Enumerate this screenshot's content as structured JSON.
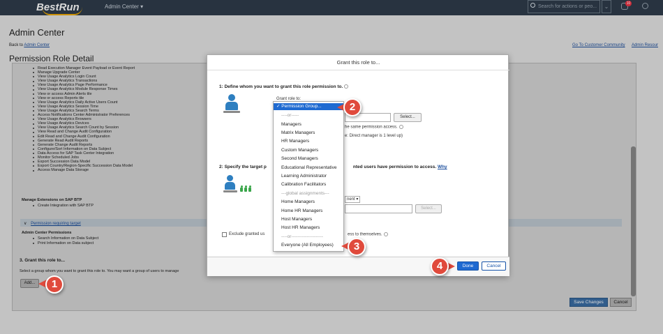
{
  "header": {
    "logo": "BestRun",
    "app_menu": "Admin Center ▾",
    "search_placeholder": "Search for actions or peo...",
    "notification_count": "10"
  },
  "page": {
    "title": "Admin Center",
    "back_prefix": "Back to ",
    "back_link": "Admin Center",
    "link_community": "Go To Customer Community",
    "link_resources": "Admin Resour",
    "section_title": "Permission Role Detail"
  },
  "permissions": [
    "Read Execution Manager Event Payload or Event Report",
    "Manage Upgrade Center",
    "View Usage Analytics Login Count",
    "View Usage Analytics Transactions",
    "View Usage Analytics Page Performance",
    "View Usage Analytics Module Response Times",
    "View or access Admin Alerts tile",
    "View or access Reports tile",
    "View Usage Analytics Daily Active Users Count",
    "View Usage Analytics Session Time",
    "View Usage Analytics Search Terms",
    "Access Notifications Center Administrator Preferences",
    "View Usage Analytics Browsers",
    "View Usage Analytics Devices",
    "View Usage Analytics Search Count by Session",
    "View Read and Change Audit Configuration",
    "Edit Read and Change Audit Configuration",
    "Generate Read Audit Reports",
    "Generate Change Audit Reports",
    "Configure/Sort Information on Data Subject",
    "Data Access for SAP Task Center Integration",
    "Monitor Scheduled Jobs",
    "Export Succession Data Model",
    "Export Country/Region-Specific Succession Data Model",
    "Access Manage Data Storage"
  ],
  "extensions": {
    "heading": "Manage Extensions on SAP BTP",
    "item": "Create Integration with SAP BTP"
  },
  "requiring_target": {
    "label": "Permission requiring target",
    "chevron": "∨"
  },
  "admin_center_permissions": {
    "heading": "Admin Center Permissions",
    "items": [
      "Search Information on Data Subject",
      "Print Information on Data subject"
    ]
  },
  "grant_section": {
    "title": "3. Grant this role to...",
    "description": "Select a group whom you want to grant this role to. You may want a group of users to manage",
    "add_label": "Add..."
  },
  "footer_buttons": {
    "save": "Save Changes",
    "cancel": "Cancel"
  },
  "dialog": {
    "title": "Grant this role to...",
    "step1": "1: Define whom you want to grant this role permission to.",
    "grant_role_to": "Grant role to:",
    "select_label": "Select...",
    "same_access": "he same permission access.",
    "manager_note": "e: Direct manager is 1 level up)",
    "step2_prefix": "2: Specify the target p",
    "step2_suffix": "nted users have permission to access.",
    "why": "Why",
    "select2_fragment": "nent ▾",
    "select2_label": "Select...",
    "exclude_prefix": "Exclude granted us",
    "exclude_suffix": "ess to themselves.",
    "done": "Done",
    "cancel": "Cancel"
  },
  "dropdown": {
    "selected": "✓ Permission Group...",
    "items": [
      "----or-----",
      "Managers",
      "Matrix Managers",
      "HR Managers",
      "Custom Managers",
      "Second Managers",
      "Educational Representative",
      "Learning Administrator",
      "Calibration Facilitators",
      "---global assignments---",
      "Home Managers",
      "Home HR Managers",
      "Host Managers",
      "Host HR Managers",
      "----or---------------------",
      "Everyone (All Employees)"
    ]
  },
  "markers": [
    "1",
    "2",
    "3",
    "4"
  ],
  "colors": {
    "topbar": "#2f3d4c",
    "brand_accent": "#f0ab00",
    "primary_button": "#1f6ad1",
    "marker": "#e04a3c",
    "person_blue": "#2e7fc0",
    "person_green": "#3aa64a"
  }
}
